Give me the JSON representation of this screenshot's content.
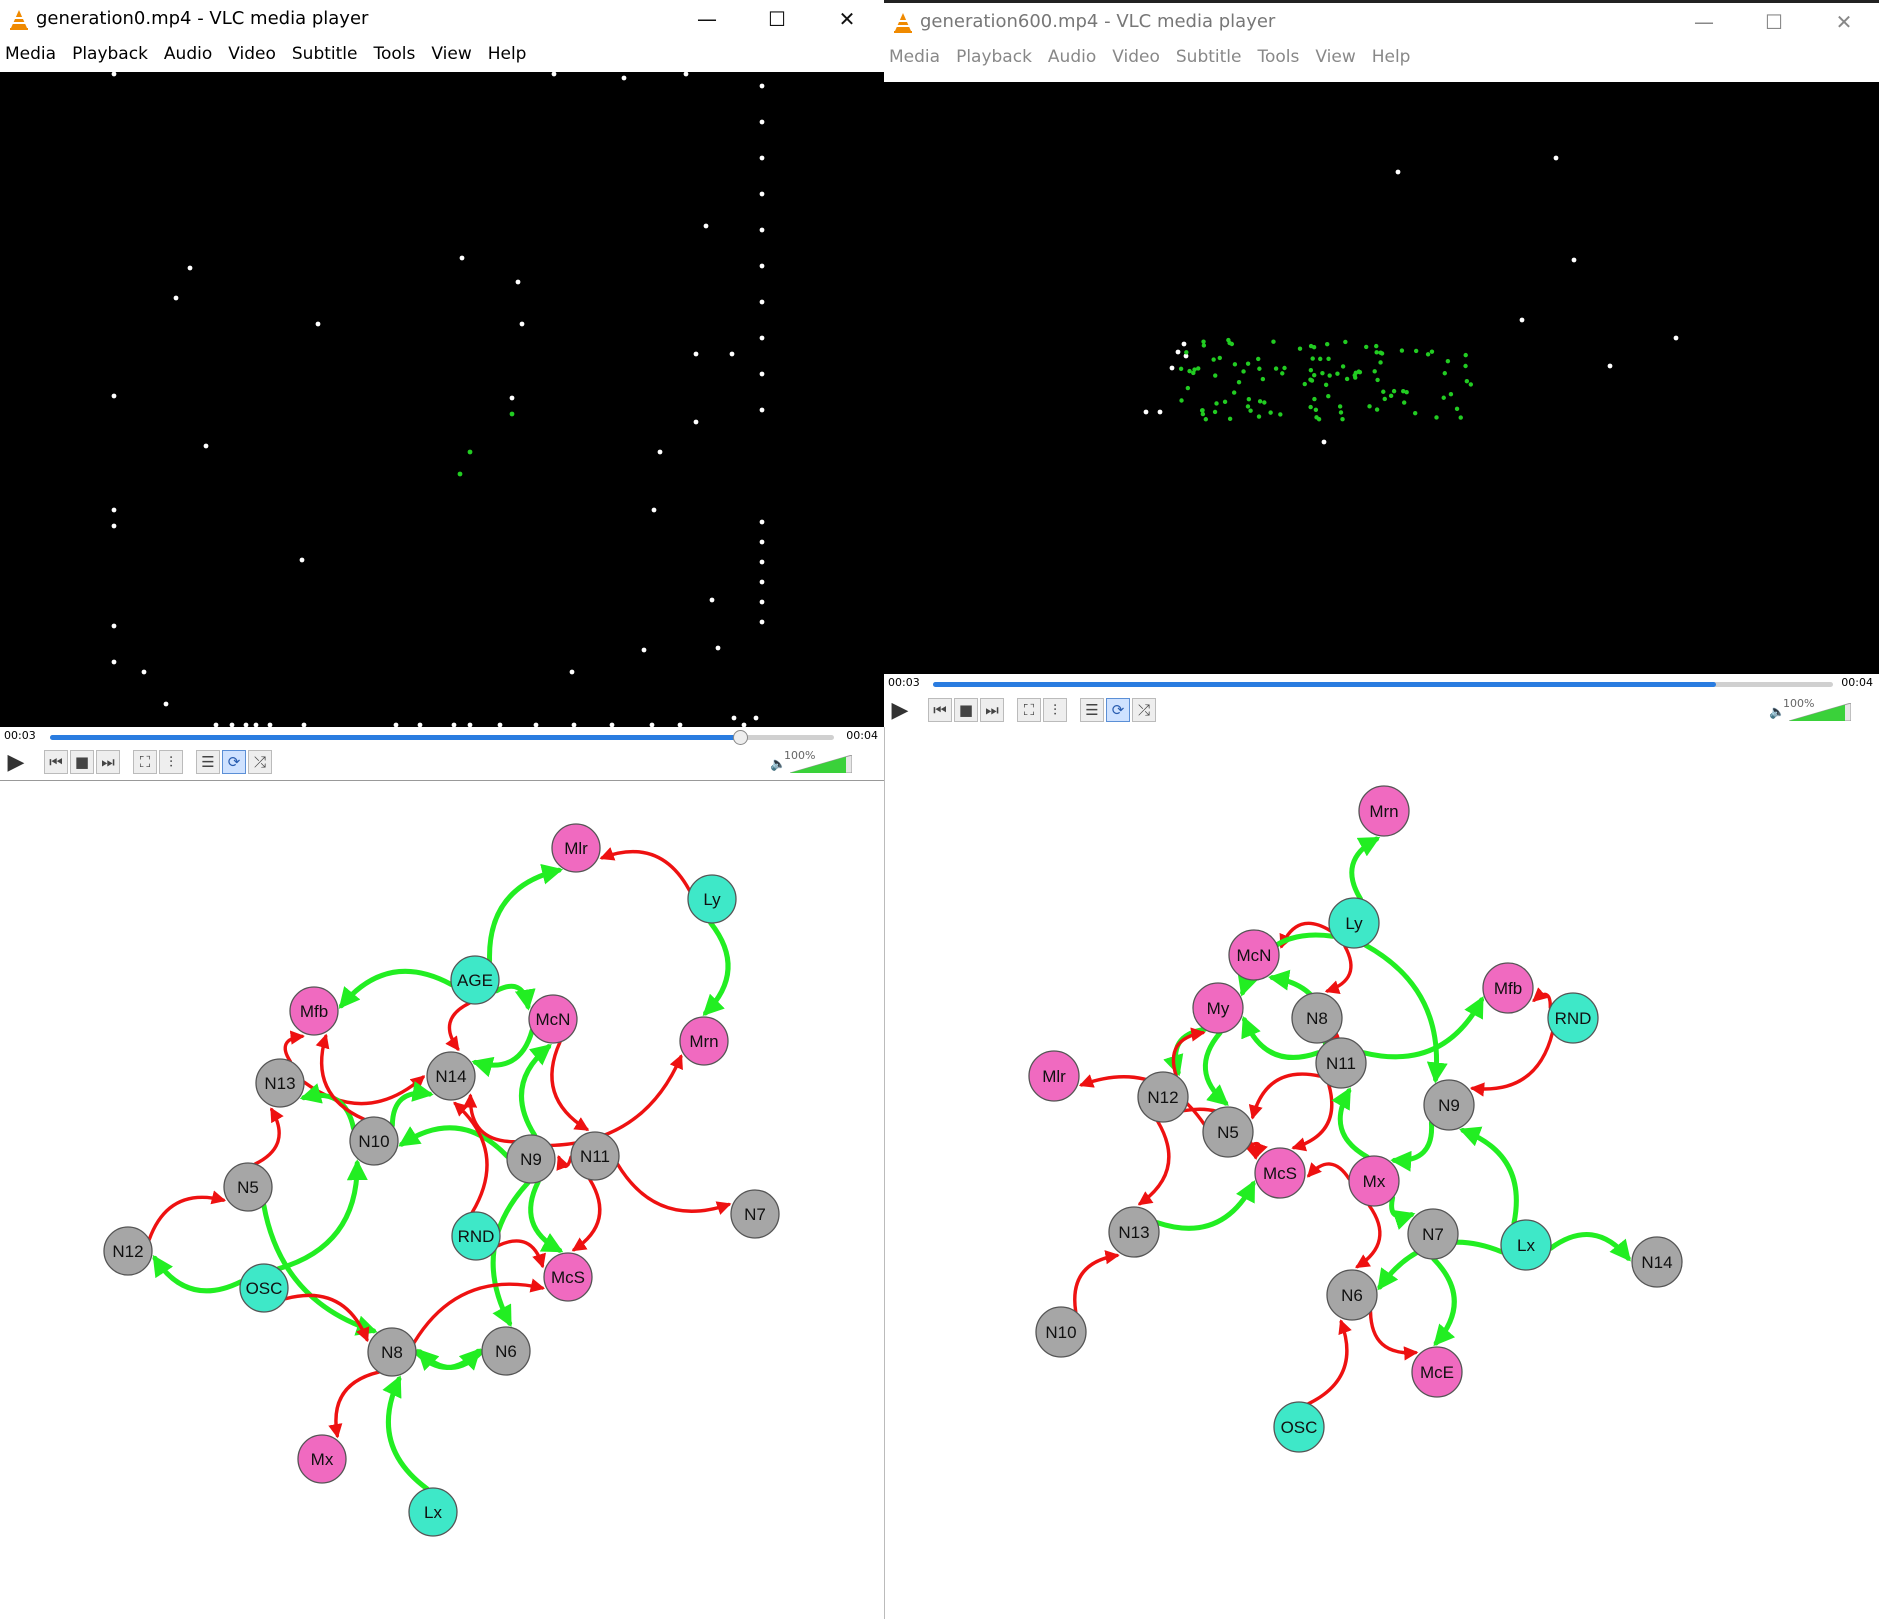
{
  "windows": [
    {
      "title": "generation0.mp4 - VLC media player",
      "menu": [
        "Media",
        "Playback",
        "Audio",
        "Video",
        "Subtitle",
        "Tools",
        "View",
        "Help"
      ],
      "controls": {
        "play": "▶",
        "prev": "⏮",
        "stop": "■",
        "next": "⏭",
        "fullscreen": "⛶",
        "ext": "⫶",
        "playlist": "☰",
        "loop": "⟳",
        "random": "⤮"
      },
      "time_current": "00:03",
      "time_total": "00:04",
      "seek_progress": 0.88,
      "volume_label": "100%",
      "volume_level": 1.0
    },
    {
      "title": "generation600.mp4 - VLC media player",
      "menu": [
        "Media",
        "Playback",
        "Audio",
        "Video",
        "Subtitle",
        "Tools",
        "View",
        "Help"
      ],
      "controls": {
        "play": "▶",
        "prev": "⏮",
        "stop": "■",
        "next": "⏭",
        "fullscreen": "⛶",
        "ext": "⫶",
        "playlist": "☰",
        "loop": "⟳",
        "random": "⤮"
      },
      "time_current": "00:03",
      "time_total": "00:04",
      "seek_progress": 0.87,
      "volume_label": "100%",
      "volume_level": 1.0
    }
  ],
  "window_buttons": {
    "minimize": "—",
    "maximize": "☐",
    "close": "✕"
  },
  "colors": {
    "sensor": "#3ee8c8",
    "motor": "#f06ac0",
    "hidden": "#a6a6a6",
    "excite": "#22ee22",
    "inhibit": "#ee1111",
    "particle": "#ffffff",
    "agent": "#22cc22",
    "accent": "#2a7ce0"
  },
  "networks": [
    {
      "nodes": [
        {
          "id": "Mlr",
          "type": "motor"
        },
        {
          "id": "Ly",
          "type": "sensor"
        },
        {
          "id": "AGE",
          "type": "sensor"
        },
        {
          "id": "Mfb",
          "type": "motor"
        },
        {
          "id": "McN",
          "type": "motor"
        },
        {
          "id": "Mrn",
          "type": "motor"
        },
        {
          "id": "N13",
          "type": "hidden"
        },
        {
          "id": "N14",
          "type": "hidden"
        },
        {
          "id": "N10",
          "type": "hidden"
        },
        {
          "id": "N9",
          "type": "hidden"
        },
        {
          "id": "N11",
          "type": "hidden"
        },
        {
          "id": "N7",
          "type": "hidden"
        },
        {
          "id": "N5",
          "type": "hidden"
        },
        {
          "id": "RND",
          "type": "sensor"
        },
        {
          "id": "N12",
          "type": "hidden"
        },
        {
          "id": "OSC",
          "type": "sensor"
        },
        {
          "id": "McS",
          "type": "motor"
        },
        {
          "id": "N8",
          "type": "hidden"
        },
        {
          "id": "N6",
          "type": "hidden"
        },
        {
          "id": "Mx",
          "type": "motor"
        },
        {
          "id": "Lx",
          "type": "sensor"
        }
      ],
      "edges": [
        [
          "AGE",
          "Mlr",
          "g"
        ],
        [
          "Ly",
          "Mlr",
          "r"
        ],
        [
          "Ly",
          "Mrn",
          "g"
        ],
        [
          "AGE",
          "Mfb",
          "g"
        ],
        [
          "AGE",
          "McN",
          "g"
        ],
        [
          "AGE",
          "N14",
          "r"
        ],
        [
          "McN",
          "N14",
          "g"
        ],
        [
          "McN",
          "N11",
          "r"
        ],
        [
          "N13",
          "Mfb",
          "r"
        ],
        [
          "N13",
          "N14",
          "r"
        ],
        [
          "N10",
          "N14",
          "g"
        ],
        [
          "N10",
          "N13",
          "g"
        ],
        [
          "N10",
          "Mfb",
          "r"
        ],
        [
          "N9",
          "N10",
          "g"
        ],
        [
          "N9",
          "N14",
          "r"
        ],
        [
          "N9",
          "Mrn",
          "r"
        ],
        [
          "N9",
          "McN",
          "g"
        ],
        [
          "N9",
          "McS",
          "g"
        ],
        [
          "N11",
          "N9",
          "r"
        ],
        [
          "N11",
          "N7",
          "r"
        ],
        [
          "N11",
          "McS",
          "r"
        ],
        [
          "N5",
          "N13",
          "r"
        ],
        [
          "N12",
          "N5",
          "r"
        ],
        [
          "N5",
          "N8",
          "g"
        ],
        [
          "OSC",
          "N12",
          "g"
        ],
        [
          "OSC",
          "N10",
          "g"
        ],
        [
          "OSC",
          "N8",
          "r"
        ],
        [
          "RND",
          "N14",
          "r"
        ],
        [
          "RND",
          "McS",
          "r"
        ],
        [
          "N9",
          "N6",
          "g"
        ],
        [
          "N6",
          "N8",
          "g"
        ],
        [
          "N8",
          "N6",
          "g"
        ],
        [
          "N8",
          "McS",
          "r"
        ],
        [
          "N8",
          "Mx",
          "r"
        ],
        [
          "Lx",
          "N8",
          "g"
        ]
      ]
    },
    {
      "nodes": [
        {
          "id": "Mrn",
          "type": "motor"
        },
        {
          "id": "Ly",
          "type": "sensor"
        },
        {
          "id": "McN",
          "type": "motor"
        },
        {
          "id": "My",
          "type": "motor"
        },
        {
          "id": "N8",
          "type": "hidden"
        },
        {
          "id": "Mfb",
          "type": "motor"
        },
        {
          "id": "RND",
          "type": "sensor"
        },
        {
          "id": "N11",
          "type": "hidden"
        },
        {
          "id": "Mlr",
          "type": "motor"
        },
        {
          "id": "N12",
          "type": "hidden"
        },
        {
          "id": "N9",
          "type": "hidden"
        },
        {
          "id": "N5",
          "type": "hidden"
        },
        {
          "id": "McS",
          "type": "motor"
        },
        {
          "id": "Mx",
          "type": "motor"
        },
        {
          "id": "N13",
          "type": "hidden"
        },
        {
          "id": "N7",
          "type": "hidden"
        },
        {
          "id": "Lx",
          "type": "sensor"
        },
        {
          "id": "N14",
          "type": "hidden"
        },
        {
          "id": "N6",
          "type": "hidden"
        },
        {
          "id": "N10",
          "type": "hidden"
        },
        {
          "id": "McE",
          "type": "motor"
        },
        {
          "id": "OSC",
          "type": "sensor"
        }
      ],
      "edges": [
        [
          "Ly",
          "Mrn",
          "g"
        ],
        [
          "Ly",
          "McN",
          "r"
        ],
        [
          "Ly",
          "N8",
          "r"
        ],
        [
          "Ly",
          "My",
          "g"
        ],
        [
          "Ly",
          "N9",
          "g"
        ],
        [
          "N11",
          "McN",
          "g"
        ],
        [
          "N11",
          "My",
          "g"
        ],
        [
          "N11",
          "Mfb",
          "g"
        ],
        [
          "N11",
          "McS",
          "r"
        ],
        [
          "N11",
          "N5",
          "r"
        ],
        [
          "N8",
          "N11",
          "r"
        ],
        [
          "RND",
          "Mfb",
          "r"
        ],
        [
          "RND",
          "N9",
          "r"
        ],
        [
          "My",
          "N12",
          "g"
        ],
        [
          "N12",
          "My",
          "r"
        ],
        [
          "N5",
          "Mlr",
          "r"
        ],
        [
          "N12",
          "N13",
          "r"
        ],
        [
          "N13",
          "McS",
          "g"
        ],
        [
          "N5",
          "McS",
          "r"
        ],
        [
          "My",
          "N5",
          "g"
        ],
        [
          "Mx",
          "N11",
          "g"
        ],
        [
          "Mx",
          "McS",
          "r"
        ],
        [
          "N9",
          "Mx",
          "g"
        ],
        [
          "Lx",
          "N9",
          "g"
        ],
        [
          "Lx",
          "N14",
          "g"
        ],
        [
          "Lx",
          "N6",
          "g"
        ],
        [
          "N7",
          "McE",
          "g"
        ],
        [
          "Mx",
          "N7",
          "g"
        ],
        [
          "Mx",
          "N6",
          "r"
        ],
        [
          "N6",
          "McE",
          "r"
        ],
        [
          "N10",
          "N13",
          "r"
        ],
        [
          "OSC",
          "N6",
          "r"
        ],
        [
          "N12",
          "McS",
          "r"
        ]
      ]
    }
  ]
}
